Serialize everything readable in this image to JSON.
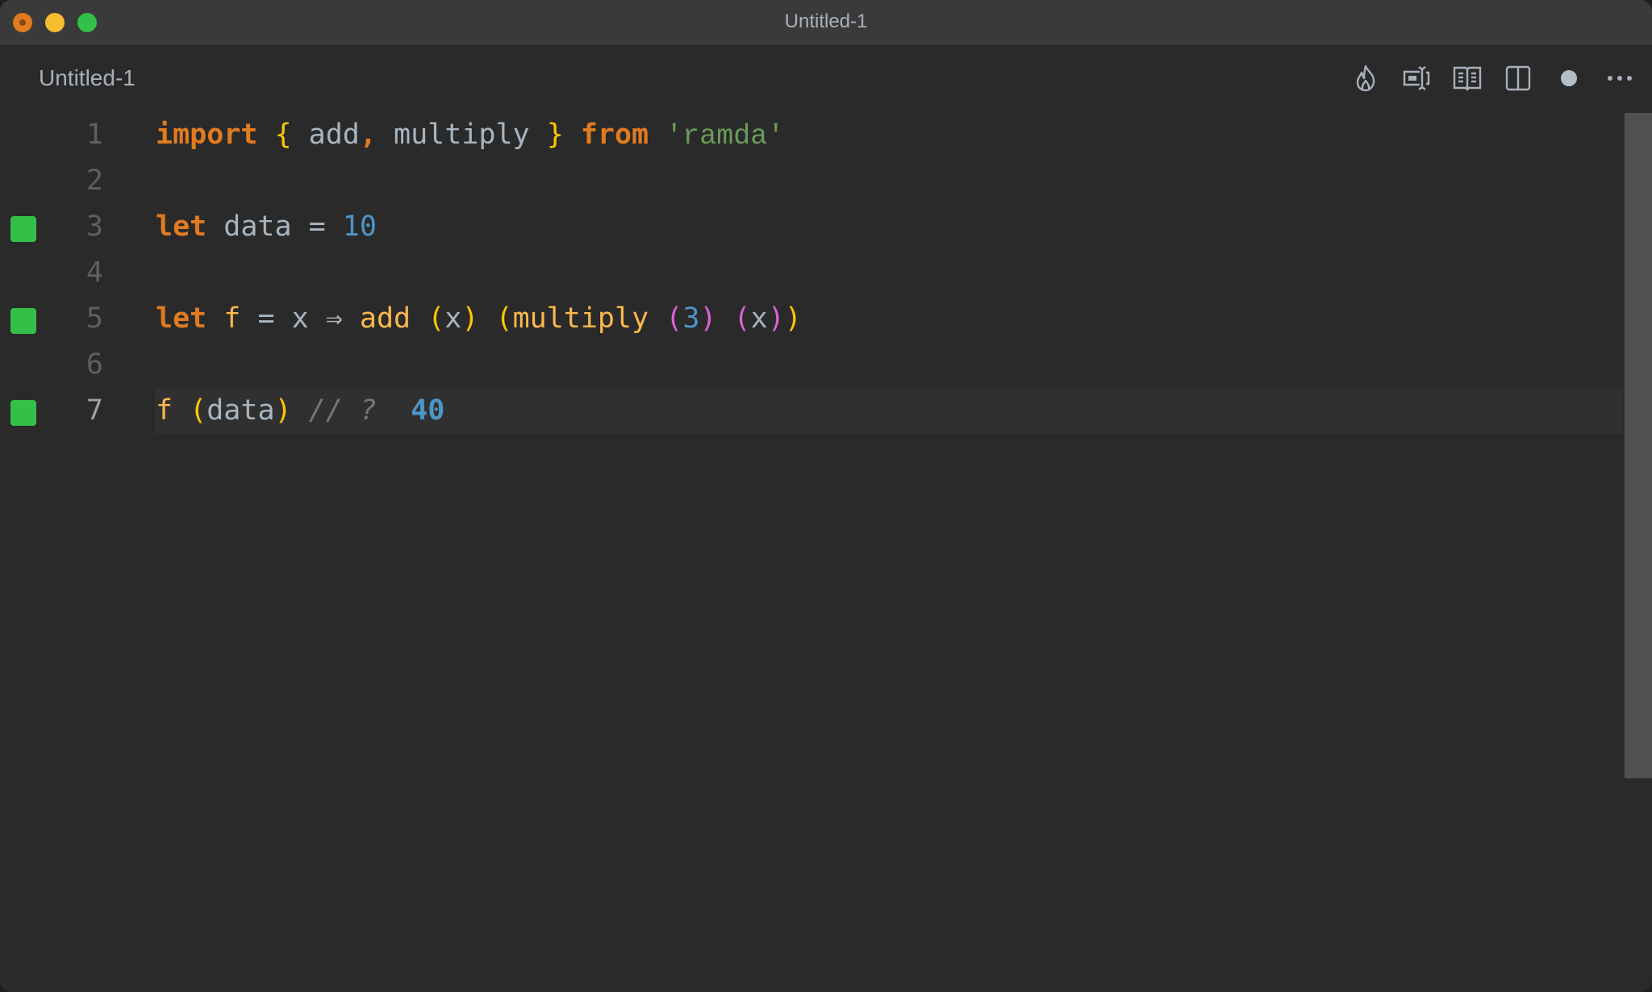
{
  "window": {
    "title": "Untitled-1",
    "traffic_lights": {
      "close": "close-button",
      "minimize": "minimize-button",
      "maximize": "maximize-button"
    }
  },
  "tab": {
    "label": "Untitled-1",
    "dirty": true
  },
  "actions": [
    {
      "name": "quokka-flame-icon",
      "label": "Quokka"
    },
    {
      "name": "toggle-inline-icon",
      "label": "Toggle inline value"
    },
    {
      "name": "open-preview-icon",
      "label": "Open preview"
    },
    {
      "name": "split-editor-icon",
      "label": "Split editor"
    },
    {
      "name": "unsaved-dot-icon",
      "label": "Unsaved changes"
    },
    {
      "name": "more-actions-icon",
      "label": "More actions"
    }
  ],
  "editor": {
    "current_line": 7,
    "lines": [
      {
        "n": "1",
        "marker": false,
        "tokens": [
          {
            "t": "import",
            "c": "kw"
          },
          {
            "t": " "
          },
          {
            "t": "{",
            "c": "br1"
          },
          {
            "t": " add"
          },
          {
            "t": ",",
            "c": "kw"
          },
          {
            "t": " multiply "
          },
          {
            "t": "}",
            "c": "br1"
          },
          {
            "t": " "
          },
          {
            "t": "from",
            "c": "kw"
          },
          {
            "t": " "
          },
          {
            "t": "'ramda'",
            "c": "str"
          }
        ]
      },
      {
        "n": "2",
        "marker": false,
        "tokens": []
      },
      {
        "n": "3",
        "marker": true,
        "tokens": [
          {
            "t": "let",
            "c": "kw"
          },
          {
            "t": " data = "
          },
          {
            "t": "10",
            "c": "num"
          }
        ]
      },
      {
        "n": "4",
        "marker": false,
        "tokens": []
      },
      {
        "n": "5",
        "marker": true,
        "tokens": [
          {
            "t": "let",
            "c": "kw"
          },
          {
            "t": " "
          },
          {
            "t": "f",
            "c": "fn"
          },
          {
            "t": " = x ⇒ "
          },
          {
            "t": "add",
            "c": "fn"
          },
          {
            "t": " "
          },
          {
            "t": "(",
            "c": "br1"
          },
          {
            "t": "x"
          },
          {
            "t": ")",
            "c": "br1"
          },
          {
            "t": " "
          },
          {
            "t": "(",
            "c": "br1"
          },
          {
            "t": "multiply",
            "c": "fn"
          },
          {
            "t": " "
          },
          {
            "t": "(",
            "c": "br2"
          },
          {
            "t": "3",
            "c": "num"
          },
          {
            "t": ")",
            "c": "br2"
          },
          {
            "t": " "
          },
          {
            "t": "(",
            "c": "br2"
          },
          {
            "t": "x"
          },
          {
            "t": ")",
            "c": "br2"
          },
          {
            "t": ")",
            "c": "br1"
          }
        ]
      },
      {
        "n": "6",
        "marker": false,
        "tokens": []
      },
      {
        "n": "7",
        "marker": true,
        "tokens": [
          {
            "t": "f",
            "c": "fn"
          },
          {
            "t": " "
          },
          {
            "t": "(",
            "c": "br1"
          },
          {
            "t": "data"
          },
          {
            "t": ")",
            "c": "br1"
          },
          {
            "t": " "
          },
          {
            "t": "// ?",
            "c": "cm"
          },
          {
            "t": "  "
          },
          {
            "t": "40",
            "c": "res"
          }
        ]
      }
    ]
  },
  "scrollbar": {
    "position": 0,
    "visible_fraction": 0.76
  },
  "colors": {
    "keyword": "#e07b20",
    "bracket_level1": "#ffc800",
    "bracket_level2": "#e060d8",
    "string": "#6a9a5a",
    "number": "#4e94c8",
    "function": "#ffb84d",
    "comment": "#707a70",
    "coverage_marker": "#33c048"
  }
}
